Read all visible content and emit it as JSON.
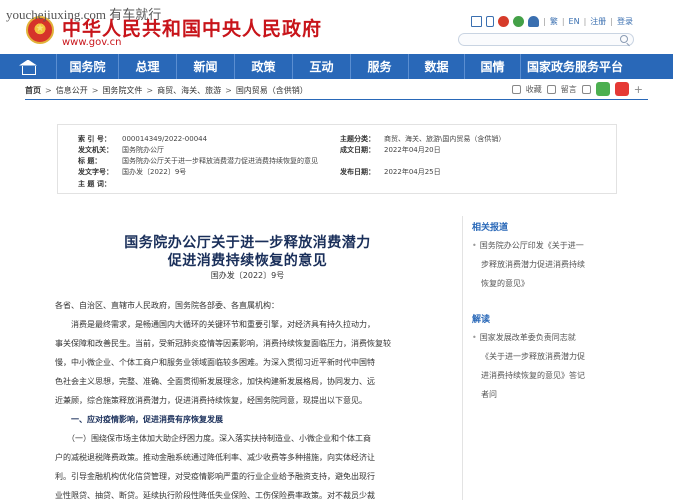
{
  "watermark": "youchejiuxing.com 有车就行",
  "header": {
    "site_title": "中华人民共和国中央人民政府",
    "site_url": "www.gov.cn",
    "links": [
      "繁",
      "EN",
      "注册",
      "登录"
    ]
  },
  "nav": {
    "items": [
      "国务院",
      "总理",
      "新闻",
      "政策",
      "互动",
      "服务",
      "数据",
      "国情",
      "国家政务服务平台"
    ]
  },
  "breadcrumb": {
    "items": [
      "首页",
      "信息公开",
      "国务院文件",
      "商贸、海关、旅游",
      "国内贸易（含供销）"
    ]
  },
  "tools": {
    "favorite": "收藏",
    "print": "留言"
  },
  "info": {
    "index_no_label": "索 引 号：",
    "index_no": "000014349/2022-00044",
    "subject_label": "主题分类：",
    "subject": "商贸、海关、旅游\\国内贸易（含供销）",
    "issuer_label": "发文机关：",
    "issuer": "国务院办公厅",
    "created_label": "成文日期：",
    "created": "2022年04月20日",
    "title_label": "标    题：",
    "title": "国务院办公厅关于进一步释放消费潜力促进消费持续恢复的意见",
    "docnum_label": "发文字号：",
    "docnum": "国办发〔2022〕9号",
    "published_label": "发布日期：",
    "published": "2022年04月25日",
    "keywords_label": "主 题 词："
  },
  "article": {
    "title_line1": "国务院办公厅关于进一步释放消费潜力",
    "title_line2": "促进消费持续恢复的意见",
    "docno": "国办发〔2022〕9号",
    "lines": [
      "各省、自治区、直辖市人民政府，国务院各部委、各直属机构：",
      "　　消费是最终需求，是畅通国内大循环的关键环节和重要引擎，对经济具有持久拉动力，",
      "事关保障和改善民生。当前，受新冠肺炎疫情等因素影响，消费持续恢复面临压力，消费恢复较",
      "慢，中小微企业、个体工商户和服务业领域面临较多困难。为深入贯彻习近平新时代中国特",
      "色社会主义思想，完整、准确、全面贯彻新发展理念，加快构建新发展格局，协同发力、远",
      "近兼顾，综合施策释放消费潜力，促进消费持续恢复，经国务院同意，现提出以下意见。",
      "　　一、应对疫情影响，促进消费有序恢复发展",
      "　　（一）围绕保市场主体加大助企纾困力度。深入落实扶持制造业、小微企业和个体工商",
      "户的减税退税降费政策。推动金融系统通过降低利率、减少收费等多种措施，向实体经济让",
      "利。引导金融机构优化信贷管理，对受疫情影响严重的行业企业给予融资支持，避免出现行",
      "业性限贷、抽贷、断贷。延续执行阶段性降低失业保险、工伤保险费率政策。对不裁员少裁"
    ]
  },
  "sidebar": {
    "related_heading": "相关报道",
    "related_lines": [
      "国务院办公厅印发《关于进一",
      "步释放消费潜力促进消费持续",
      "恢复的意见》"
    ],
    "interpret_heading": "解读",
    "interpret_lines": [
      "国家发展改革委负责同志就",
      "《关于进一步释放消费潜力促",
      "进消费持续恢复的意见》答记",
      "者问"
    ]
  }
}
